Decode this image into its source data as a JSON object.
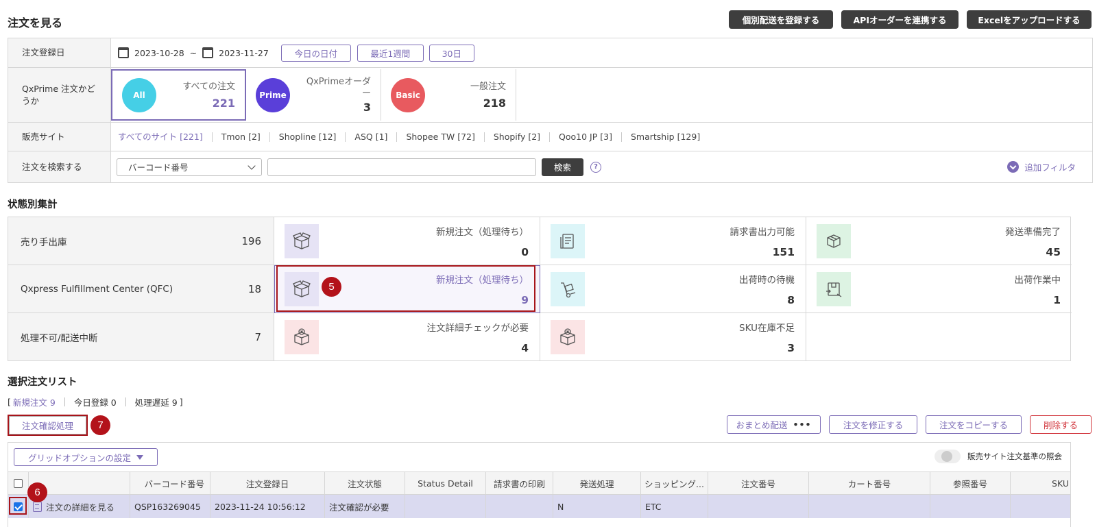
{
  "page": {
    "title": "注文を見る",
    "top_actions": [
      "個別配送を登録する",
      "APIオーダーを連携する",
      "Excelをアップロードする"
    ]
  },
  "filters": {
    "date": {
      "label": "注文登録日",
      "start": "2023-10-28",
      "tilde": "~",
      "end": "2023-11-27",
      "buttons": [
        "今日の日付",
        "最近1週間",
        "30日"
      ]
    },
    "qxprime": {
      "label": "QxPrime 注文かどうか",
      "cards": [
        {
          "badge": "All",
          "label": "すべての注文",
          "count": "221",
          "color": "#45cfe6"
        },
        {
          "badge": "Prime",
          "label": "QxPrimeオーダー",
          "count": "3",
          "color": "#5a3fd9"
        },
        {
          "badge": "Basic",
          "label": "一般注文",
          "count": "218",
          "color": "#e85a5f"
        }
      ]
    },
    "sites": {
      "label": "販売サイト",
      "items": [
        "すべてのサイト [221]",
        "Tmon [2]",
        "Shopline [12]",
        "ASQ [1]",
        "Shopee TW [72]",
        "Shopify [2]",
        "Qoo10 JP [3]",
        "Smartship [129]"
      ]
    },
    "search": {
      "label": "注文を検索する",
      "select_value": "バーコード番号",
      "input_value": "",
      "button": "検索",
      "help": "?",
      "add_filter": "追加フィルタ"
    }
  },
  "status": {
    "title": "状態別集計",
    "rows": [
      {
        "name": "売り手出庫",
        "count": "196",
        "cells": [
          {
            "label": "新規注文（処理待ち）",
            "count": "0",
            "icon": "box-open-icon"
          },
          {
            "label": "請求書出力可能",
            "count": "151",
            "icon": "invoice-icon"
          },
          {
            "label": "発送準備完了",
            "count": "45",
            "icon": "package-icon"
          }
        ]
      },
      {
        "name": "Qxpress Fulfillment Center (QFC)",
        "count": "18",
        "cells": [
          {
            "label": "新規注文（処理待ち）",
            "count": "9",
            "icon": "box-open-icon"
          },
          {
            "label": "出荷時の待機",
            "count": "8",
            "icon": "hand-truck-icon"
          },
          {
            "label": "出荷作業中",
            "count": "1",
            "icon": "package-move-icon"
          }
        ]
      },
      {
        "name": "処理不可/配送中断",
        "count": "7",
        "cells": [
          {
            "label": "注文詳細チェックが必要",
            "count": "4",
            "icon": "box-error-icon"
          },
          {
            "label": "SKU在庫不足",
            "count": "3",
            "icon": "box-error-icon"
          }
        ]
      }
    ]
  },
  "list": {
    "title": "選択注文リスト",
    "bracket_open": "[",
    "bracket_close": "]",
    "tabs": [
      "新規注文 9",
      "今日登録 0",
      "処理遅延 9"
    ],
    "confirm_button": "注文確認処理",
    "actions": [
      "おまとめ配送",
      "注文を修正する",
      "注文をコピーする",
      "削除する"
    ],
    "more_dots": "•••",
    "grid_options": "グリッドオプションの設定",
    "toggle_label": "販売サイト注文基準の照会",
    "columns": [
      "バーコード番号",
      "注文登録日",
      "注文状態",
      "Status Detail",
      "請求書の印刷",
      "発送処理",
      "ショッピング...",
      "注文番号",
      "カート番号",
      "参照番号",
      "SKU"
    ],
    "row": {
      "checked": true,
      "detail_link": "注文の詳細を見る",
      "cells": [
        "QSP163269045",
        "2023-11-24 10:56:12",
        "注文確認が必要",
        "",
        "",
        "N",
        "ETC",
        "",
        "",
        "",
        ""
      ]
    }
  },
  "annotations": {
    "badge_5": "5",
    "badge_6": "6",
    "badge_7": "7"
  }
}
